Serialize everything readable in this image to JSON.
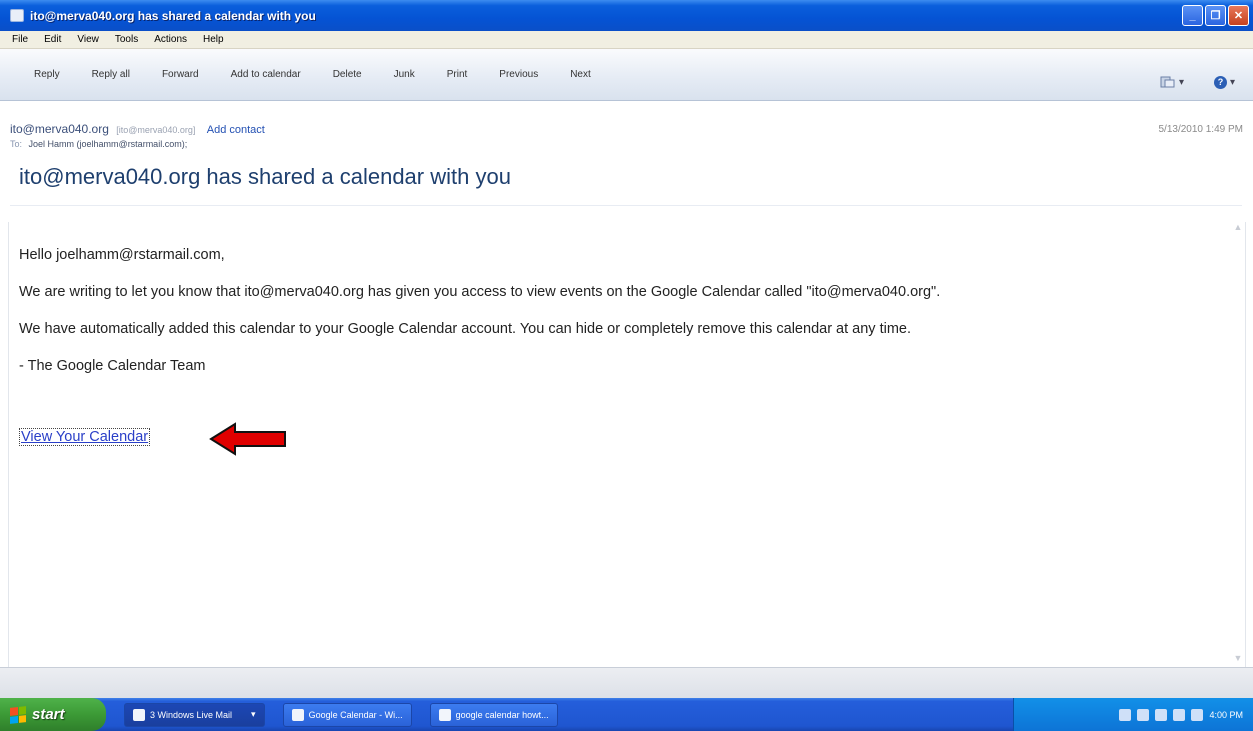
{
  "window": {
    "title": "ito@merva040.org has shared a calendar with you",
    "minimize_glyph": "_",
    "maximize_glyph": "❐",
    "close_glyph": "✕"
  },
  "menu": {
    "items": [
      "File",
      "Edit",
      "View",
      "Tools",
      "Actions",
      "Help"
    ]
  },
  "toolbar": {
    "buttons": [
      "Reply",
      "Reply all",
      "Forward",
      "Add to calendar",
      "Delete",
      "Junk",
      "Print",
      "Previous",
      "Next"
    ],
    "help_glyph": "?"
  },
  "message": {
    "from_name": "ito@merva040.org",
    "from_email": "[ito@merva040.org]",
    "add_contact": "Add contact",
    "date": "5/13/2010 1:49 PM",
    "to_label": "To:",
    "to_value": "Joel Hamm (joelhamm@rstarmail.com);",
    "subject": "ito@merva040.org has shared a calendar with you",
    "body": [
      "Hello joelhamm@rstarmail.com,",
      "We are writing to let you know that ito@merva040.org has given you access to view events on the Google Calendar called \"ito@merva040.org\".",
      "We have automatically added this calendar to your Google Calendar account. You can hide or completely remove this calendar at any time.",
      "- The Google Calendar Team"
    ],
    "link": "View Your Calendar"
  },
  "taskbar": {
    "start_label": "start",
    "tasks": [
      "3 Windows Live Mail",
      "Google Calendar - Wi...",
      "google calendar howt..."
    ],
    "clock": "4:00 PM"
  },
  "colors": {
    "titlebar": "#0553d4",
    "link": "#2a3fc8",
    "arrow": "#e00000"
  }
}
